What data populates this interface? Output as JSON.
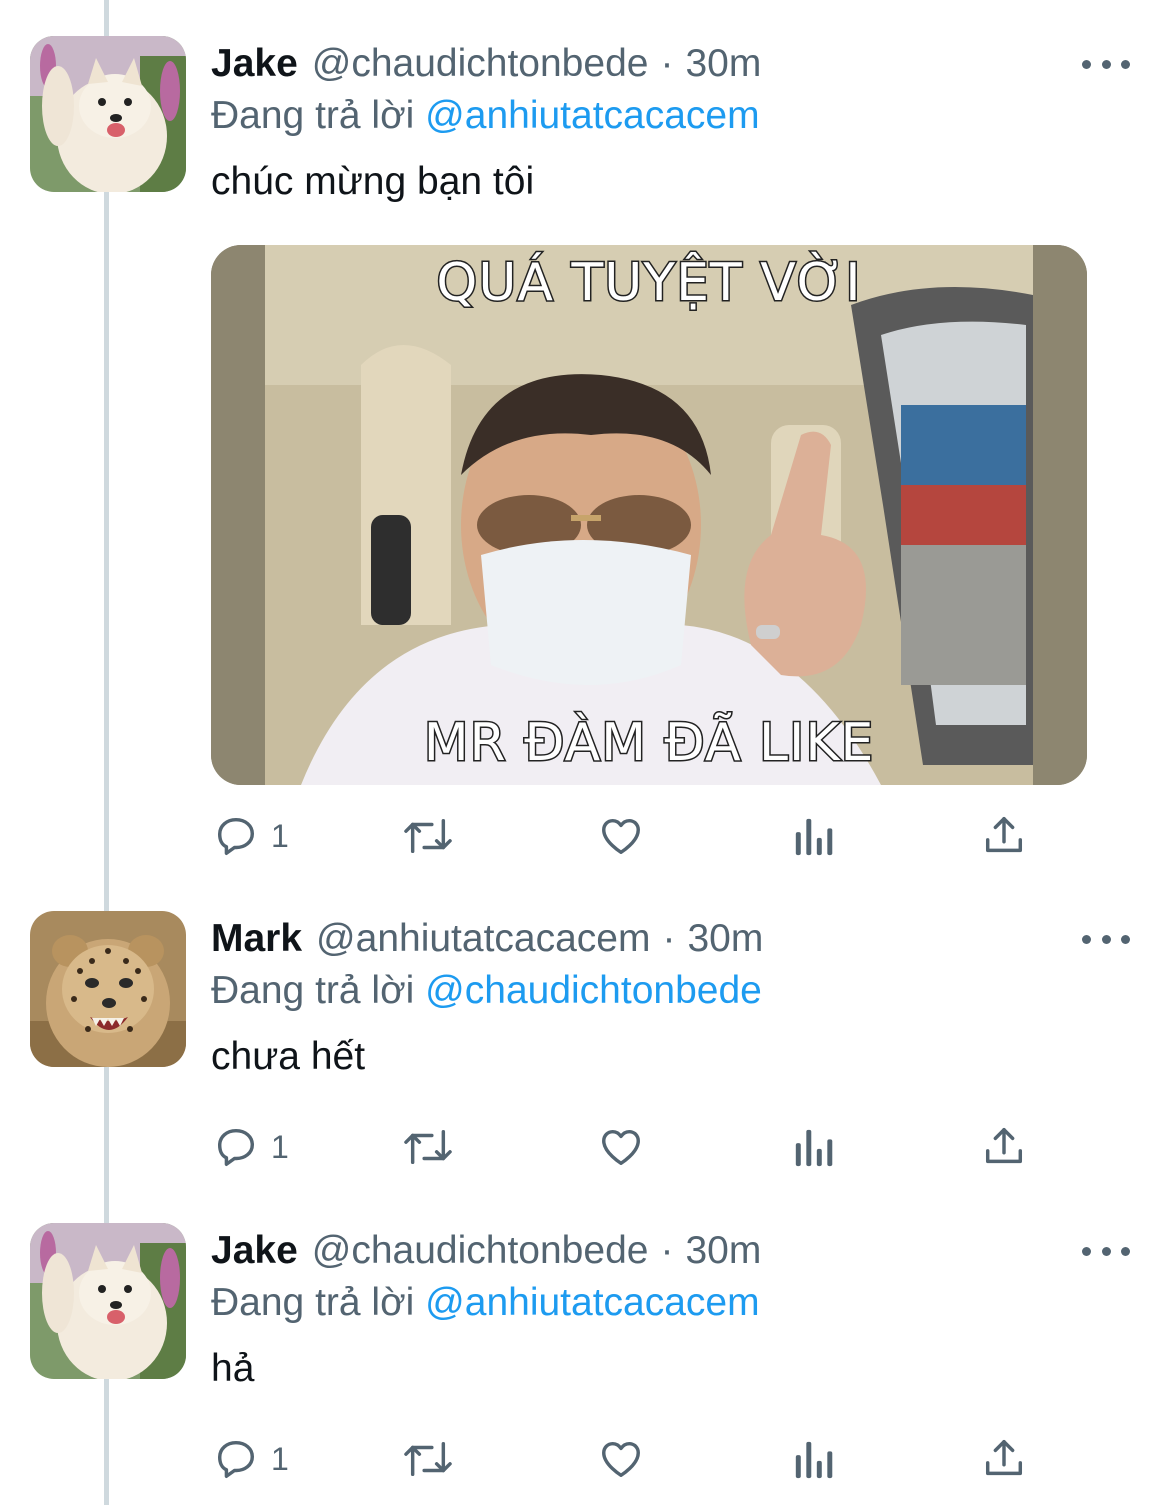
{
  "thread": [
    {
      "author": {
        "name": "Jake",
        "handle": "@chaudichtonbede",
        "avatar": "samoyed-dog-avatar"
      },
      "separator": "·",
      "time": "30m",
      "replying_prefix": "Đang trả lời",
      "replying_to": "@anhiutatcacacem",
      "text": "chúc mừng bạn tôi",
      "media": {
        "top_caption": "QUÁ TUYỆT VỜI",
        "bottom_caption": "MR ĐÀM ĐÃ LIKE"
      },
      "replies": "1"
    },
    {
      "author": {
        "name": "Mark",
        "handle": "@anhiutatcacacem",
        "avatar": "cheetah-cub-avatar"
      },
      "separator": "·",
      "time": "30m",
      "replying_prefix": "Đang trả lời",
      "replying_to": "@chaudichtonbede",
      "text": "chưa hết",
      "replies": "1"
    },
    {
      "author": {
        "name": "Jake",
        "handle": "@chaudichtonbede",
        "avatar": "samoyed-dog-avatar"
      },
      "separator": "·",
      "time": "30m",
      "replying_prefix": "Đang trả lời",
      "replying_to": "@anhiutatcacacem",
      "text": "hả",
      "replies": "1"
    }
  ],
  "icons": [
    "reply-icon",
    "retweet-icon",
    "like-icon",
    "analytics-icon",
    "share-icon",
    "more-options-icon"
  ],
  "colors": {
    "text": "#0f1419",
    "secondary": "#536471",
    "mention": "#1d9bf0",
    "thread_line": "#cfd9de"
  }
}
